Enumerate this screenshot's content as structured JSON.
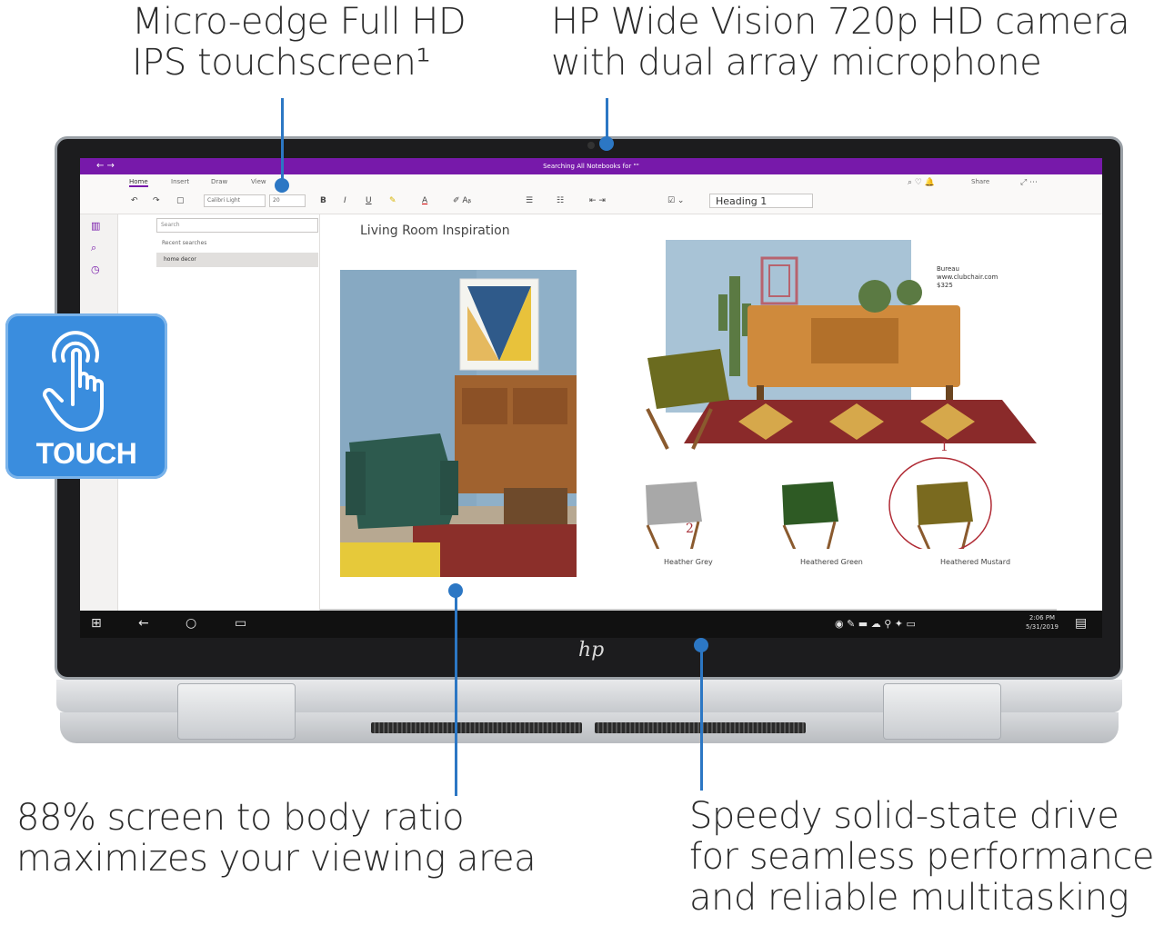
{
  "callouts": {
    "top_left": [
      "Micro-edge Full HD",
      "IPS touchscreen¹"
    ],
    "top_right": [
      "HP Wide Vision 720p HD camera",
      "with dual array microphone"
    ],
    "bottom_left": [
      "88% screen to body ratio",
      "maximizes your viewing area"
    ],
    "bottom_right": [
      "Speedy solid-state drive",
      "for seamless performance",
      "and reliable multitasking"
    ]
  },
  "touch_badge": {
    "label": "TOUCH",
    "icon": "touch-hand-icon",
    "color": "#3a8dde"
  },
  "brand_logo": "hp",
  "onenote": {
    "window_title": "Searching All Notebooks for \"\"",
    "tabs": [
      "Home",
      "Insert",
      "Draw",
      "View"
    ],
    "active_tab": "Home",
    "font_name": "Calibri Light",
    "font_size": "20",
    "style": "Heading 1",
    "share_label": "Share",
    "search_placeholder": "Search",
    "recent_label": "Recent searches",
    "recent_item": "home decor",
    "page_title": "Living Room Inspiration",
    "bureau": [
      "Bureau",
      "www.clubchair.com",
      "$325"
    ],
    "chairs": [
      "Heather Grey",
      "Heathered Green",
      "Heathered Mustard"
    ],
    "annotations": [
      "1",
      "2"
    ]
  },
  "taskbar": {
    "time": "2:06 PM",
    "date": "5/31/2019"
  },
  "colors": {
    "accent": "#2c77c4",
    "onenote_purple": "#7719aa"
  }
}
